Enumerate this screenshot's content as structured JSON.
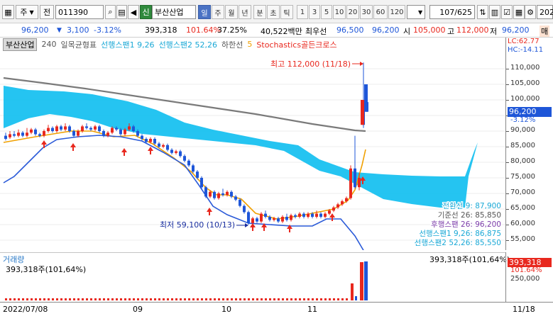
{
  "toolbar": {
    "period_label": "주",
    "prev_label": "전",
    "code": "011390",
    "market_badge": "신",
    "stock_name": "부산산업",
    "timeframes": [
      "일",
      "주",
      "월",
      "년",
      "분",
      "초",
      "틱"
    ],
    "intervals": [
      "1",
      "3",
      "5",
      "10",
      "20",
      "30",
      "60",
      "120"
    ],
    "page": "107/625",
    "date_field": "2022"
  },
  "quote": {
    "price": "96,200",
    "change": "3,100",
    "change_pct": "-3.12%",
    "volume": "393,318",
    "volume_ratio": "101.64%",
    "turnover": "37.25%",
    "amount": "40,522백만",
    "best_ask_label": "최우선",
    "best_ask": "96,500",
    "best_bid": "96,200",
    "open_label": "시",
    "open": "105,000",
    "high_label": "고",
    "high": "112,000",
    "low_label": "저",
    "low": "96,200",
    "trade_label": "매"
  },
  "legend": {
    "name": "부산산업",
    "count": "240",
    "ichimoku": "일목균형표",
    "span1": "선행스팬1 9,26",
    "span2": "선행스팬2 52,26",
    "hahan": "하한선",
    "five": "5",
    "stoch": "Stochastics골든크로스"
  },
  "annotations": {
    "high": "최고 112,000 (11/18)",
    "low": "최저 59,100 (10/13)",
    "conversion": "전환선 9: 87,900",
    "base": "기준선 26: 85,850",
    "lagging": "후행스팬 26: 96,200",
    "lead1": "선행스팬1 9,26: 86,875",
    "lead2": "선행스팬2 52,26: 85,550"
  },
  "indicators": {
    "lc": "LC:62.77",
    "hc": "HC:-14.11"
  },
  "price_axis": {
    "ticks": [
      "110,000",
      "105,000",
      "100,000",
      "95,000",
      "90,000",
      "85,000",
      "80,000",
      "75,000",
      "70,000",
      "65,000",
      "60,000",
      "55,000"
    ],
    "current": "96,200",
    "current_pct": "-3.12%"
  },
  "volume": {
    "title": "거래량",
    "value_left": "393,318주(101,64%)",
    "value_right": "393,318주(101,64%)",
    "axis_value": "393,318",
    "axis_pct": "101.64%",
    "axis_tick": "250,000"
  },
  "dates": {
    "start": "2022/07/08",
    "labels": [
      "09",
      "10",
      "11"
    ],
    "end": "11/18"
  },
  "colors": {
    "up": "#e8281e",
    "down": "#1e56d8",
    "cloud": "#19c1f0",
    "ma_gray": "#7a7a7a",
    "ma_orange": "#f0a000",
    "lower_band": "#2a5ad8"
  }
}
